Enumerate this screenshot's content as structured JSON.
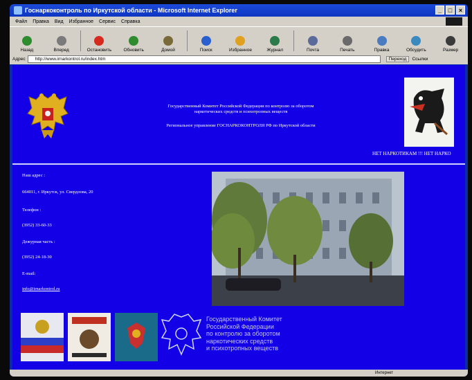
{
  "window": {
    "title": "Госнаркоконтроль по Иркутской области - Microsoft Internet Explorer"
  },
  "menu": [
    "Файл",
    "Правка",
    "Вид",
    "Избранное",
    "Сервис",
    "Справка"
  ],
  "toolbar": [
    {
      "label": "Назад",
      "icon": "back-arrow-icon",
      "color": "#2e8b2e"
    },
    {
      "label": "Вперед",
      "icon": "forward-arrow-icon",
      "color": "#7a7a7a"
    },
    {
      "label": "Остановить",
      "icon": "stop-icon",
      "color": "#d62a1e"
    },
    {
      "label": "Обновить",
      "icon": "refresh-icon",
      "color": "#2e8b2e"
    },
    {
      "label": "Домой",
      "icon": "home-icon",
      "color": "#7a6a3a"
    },
    {
      "label": "Поиск",
      "icon": "search-icon",
      "color": "#2a5fd0"
    },
    {
      "label": "Избранное",
      "icon": "favorites-icon",
      "color": "#e0a020"
    },
    {
      "label": "Журнал",
      "icon": "history-icon",
      "color": "#2a7a4a"
    },
    {
      "label": "Почта",
      "icon": "mail-icon",
      "color": "#5a6a9a"
    },
    {
      "label": "Печать",
      "icon": "print-icon",
      "color": "#6a6a6a"
    },
    {
      "label": "Правка",
      "icon": "edit-icon",
      "color": "#4a7ac0"
    },
    {
      "label": "Обсудить",
      "icon": "discuss-icon",
      "color": "#3a8ac0"
    },
    {
      "label": "Размер",
      "icon": "size-icon",
      "color": "#3a3a3a"
    }
  ],
  "address": {
    "label": "Адрес",
    "url": "http://www.irnarkontrol.ru/index.htm",
    "go_label": "Переход",
    "links_label": "Ссылки"
  },
  "page": {
    "agency_line1": "Государственный Комитет Российской Федерации по контролю за оборотом",
    "agency_line2": "наркотических средств и психотропных веществ",
    "region_line": "Региональное управление ГОСНАРКОКОНТРОЛЯ РФ по Иркутской области",
    "slogan": "НЕТ НАРКОТИКАМ !!! НЕТ НАРКО",
    "address_heading": "Наш адрес :",
    "address_value": "664011, г. Иркутск, ул. Свердлова, 20",
    "phone_heading": "Телефон :",
    "phone_value": "(3952) 33-60-33",
    "duty_heading": "Дежурная часть :",
    "duty_value": "(3952) 24-18-30",
    "email_heading": "E-mail:",
    "email_value": "info@irnarkontrol.ru",
    "big_banner_line1": "Государственный Комитет",
    "big_banner_line2": "Российской Федерации",
    "big_banner_line3": "по контролю за оборотом",
    "big_banner_line4": "наркотических средств",
    "big_banner_line5": "и психотропных веществ"
  },
  "status": {
    "zone": "Интернет"
  },
  "colors": {
    "page_background": "#1400e6",
    "titlebar": "#0d36c2",
    "chrome": "#d4d0c8"
  }
}
